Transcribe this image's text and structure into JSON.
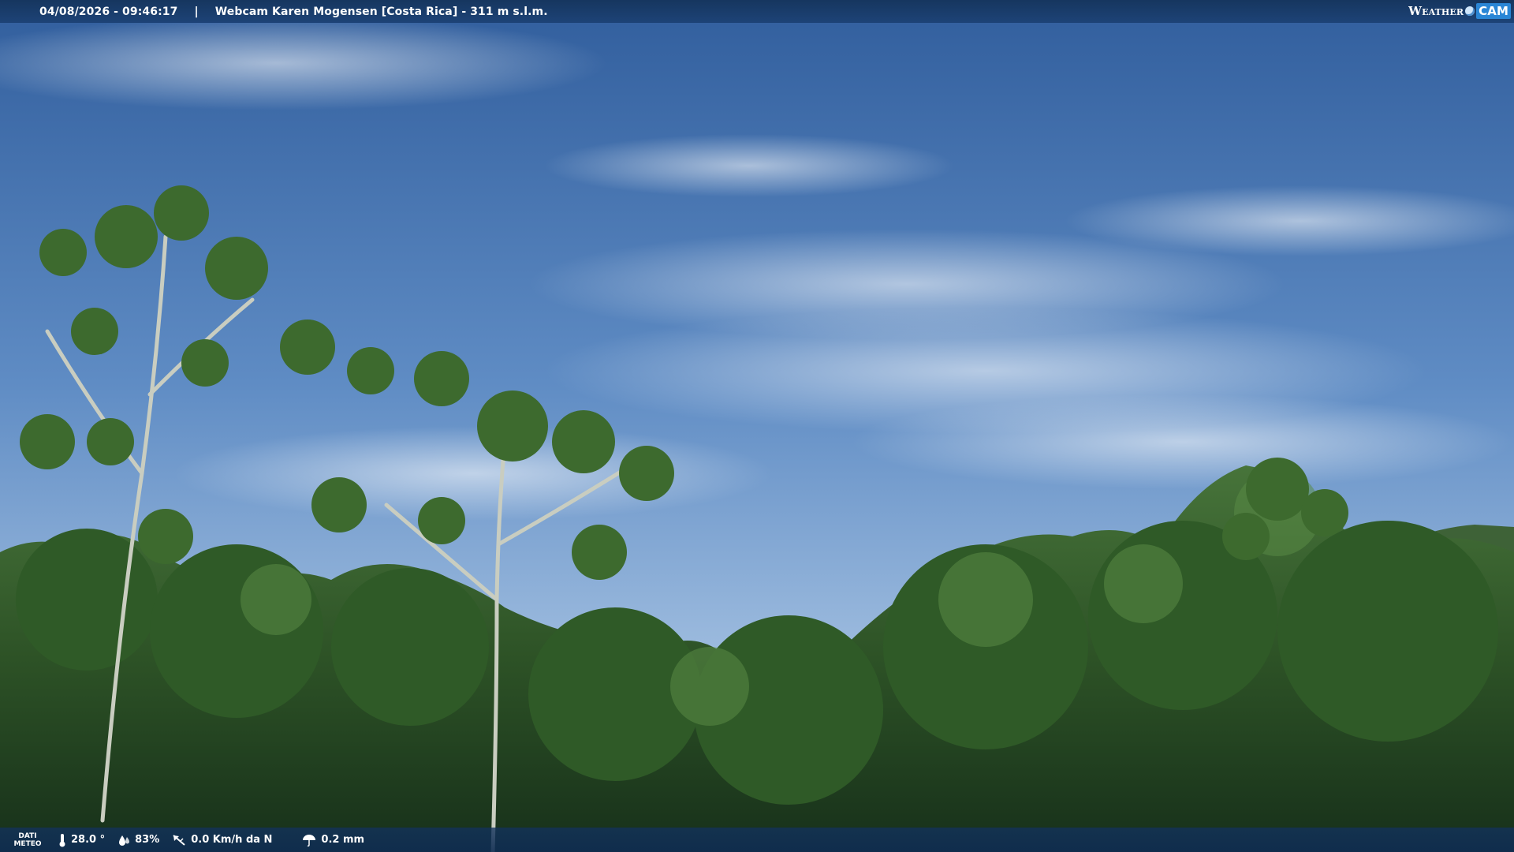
{
  "overlay": {
    "timestamp": "04/08/2026 - 09:46:17",
    "separator": "|",
    "location": "Webcam Karen Mogensen [Costa Rica]  - 311 m s.l.m.",
    "brand_weather": "Weather",
    "brand_cam": "CAM"
  },
  "meteo": {
    "tag_line1": "DATI",
    "tag_line2": "METEO",
    "temperature": "28.0 °",
    "humidity": "83%",
    "wind": "0.0 Km/h da N",
    "rain": "0.2 mm"
  },
  "colors": {
    "sky_top": "#3a68a6",
    "sky_bottom": "#9ebde0",
    "foliage_dark": "#1e3a1a",
    "foliage_mid": "#3f6a2c",
    "bar": "#1d4377"
  }
}
